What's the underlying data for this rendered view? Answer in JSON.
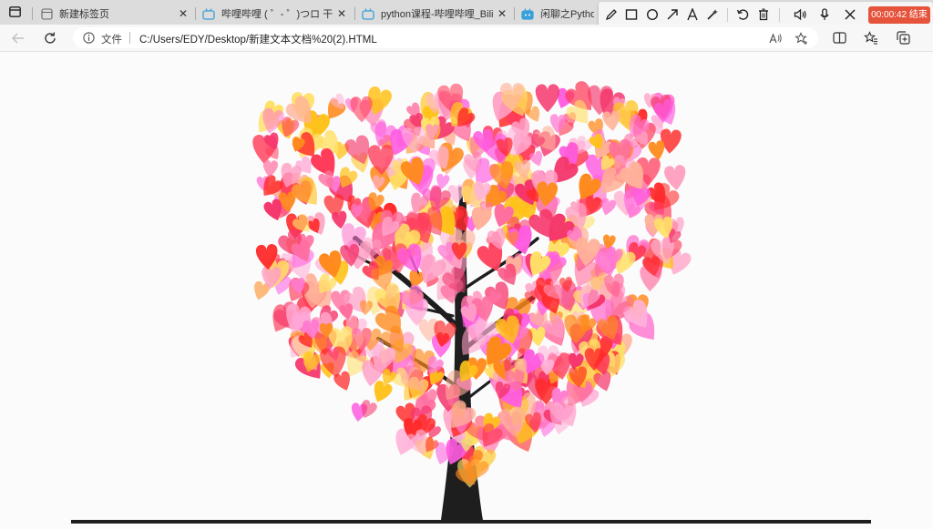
{
  "browser": {
    "tabs": [
      {
        "title": "新建标签页",
        "favicon": "new-tab-icon"
      },
      {
        "title": "哔哩哔哩 ( ゜- ゜)つロ 干杯~-bilibili",
        "favicon": "bilibili-tv-icon"
      },
      {
        "title": "python课程-哔哩哔哩_Bilibili",
        "favicon": "bilibili-tv-icon"
      },
      {
        "title": "闲聊之Python",
        "favicon": "bilibili-tv-icon"
      }
    ],
    "address": {
      "label": "文件",
      "url": "C:/Users/EDY/Desktop/新建文本文档%20(2).HTML"
    }
  },
  "recorder": {
    "timer_text": "00:00:42 结束",
    "tools": [
      "pencil-icon",
      "rectangle-icon",
      "circle-icon",
      "arrow-icon",
      "text-icon",
      "magic-wand-icon",
      "undo-icon",
      "trash-icon",
      "speaker-icon",
      "microphone-icon",
      "close-icon"
    ],
    "accent": "#e5533c"
  },
  "page": {
    "background": "#fbfbfb",
    "heart_colors": [
      "#ff6fa0",
      "#ff3d5a",
      "#ffc21a",
      "#ff8a1c",
      "#ff9ec4",
      "#ff5ce0",
      "#ffb199",
      "#ff2a2a",
      "#ff7ad1",
      "#ffe066",
      "#f5366c",
      "#ffb3d9"
    ],
    "trunk_color": "#1e1e1e"
  }
}
